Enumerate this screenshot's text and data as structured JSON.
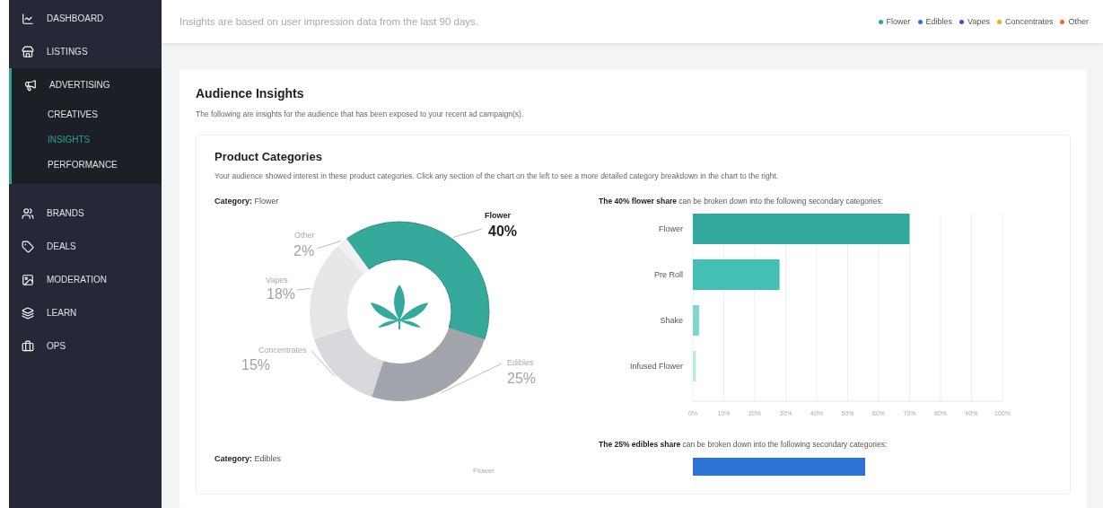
{
  "sidebar": {
    "items": [
      {
        "label": "DASHBOARD",
        "selected": false
      },
      {
        "label": "LISTINGS",
        "selected": false
      },
      {
        "label": "ADVERTISING",
        "expanded": true,
        "children": [
          {
            "label": "CREATIVES",
            "selected": false
          },
          {
            "label": "INSIGHTS",
            "selected": true
          },
          {
            "label": "PERFORMANCE",
            "selected": false
          }
        ]
      },
      {
        "label": "BRANDS",
        "selected": false
      },
      {
        "label": "DEALS",
        "selected": false
      },
      {
        "label": "MODERATION",
        "selected": false
      },
      {
        "label": "LEARN",
        "selected": false
      },
      {
        "label": "OPS",
        "selected": false
      }
    ]
  },
  "top_bar": {
    "note": "Insights are based on user impression data from the last 90 days.",
    "legend": [
      {
        "label": "Flower",
        "color": "#26a69a"
      },
      {
        "label": "Edibles",
        "color": "#2f6fd6"
      },
      {
        "label": "Vapes",
        "color": "#6a3fc6"
      },
      {
        "label": "Concentrates",
        "color": "#f5a623"
      },
      {
        "label": "Other",
        "color": "#f26522"
      }
    ]
  },
  "audience": {
    "title": "Audience Insights",
    "subtitle": "The following are insights for the audience that has been exposed to your recent ad campaign(s).",
    "product_categories": {
      "title": "Product Categories",
      "description": "Your audience showed interest in these product categories. Click any section of the chart on the left to see a more detailed category breakdown in the chart to the right.",
      "sections": [
        {
          "category_label": "Category:",
          "category": "Flower",
          "breakdown_heading": "**The 40% flower share** can be broken down into the following secondary categories:",
          "donut": {
            "chart_data": {
              "type": "donut",
              "categories": [
                "Flower",
                "Edibles",
                "Concentrates",
                "Vapes",
                "Other"
              ],
              "values": [
                40,
                25,
                15,
                18,
                2
              ],
              "colors": [
                "#36a99d",
                "#a2a5ab",
                "#d8d9dc",
                "#e6e7e9",
                "#f1f1f2"
              ],
              "value_labels": [
                "40%",
                "25%",
                "15%",
                "18%",
                "2%"
              ]
            },
            "selected": [
              true,
              false,
              false,
              false,
              false
            ]
          },
          "bars": {
            "chart_data": {
              "type": "bar",
              "orientation": "horizontal",
              "categories": [
                "Flower",
                "Pre Roll",
                "Shake",
                "Infused Flower"
              ],
              "values": [
                70,
                28,
                2,
                1
              ],
              "colors": [
                "#33a89c",
                "#43bfb4",
                "#7fd6cd",
                "#b8ebe5"
              ],
              "grid": true,
              "xlim": [
                0,
                100
              ],
              "xticks": [
                {
                  "value": 0,
                  "label": "0%"
                },
                {
                  "value": 10,
                  "label": "10%"
                },
                {
                  "value": 20,
                  "label": "20%"
                },
                {
                  "value": 30,
                  "label": "30%"
                },
                {
                  "value": 40,
                  "label": "40%"
                },
                {
                  "value": 50,
                  "label": "50%"
                },
                {
                  "value": 60,
                  "label": "60%"
                },
                {
                  "value": 70,
                  "label": "70%"
                },
                {
                  "value": 80,
                  "label": "80%"
                },
                {
                  "value": 90,
                  "label": "90%"
                },
                {
                  "value": 100,
                  "label": "100%"
                }
              ]
            }
          }
        },
        {
          "category_label": "Category:",
          "category": "Edibles",
          "breakdown_heading": "**The 25% edibles share** can be broken down into the following secondary categories:",
          "donut_label": "Flower"
        }
      ]
    }
  }
}
